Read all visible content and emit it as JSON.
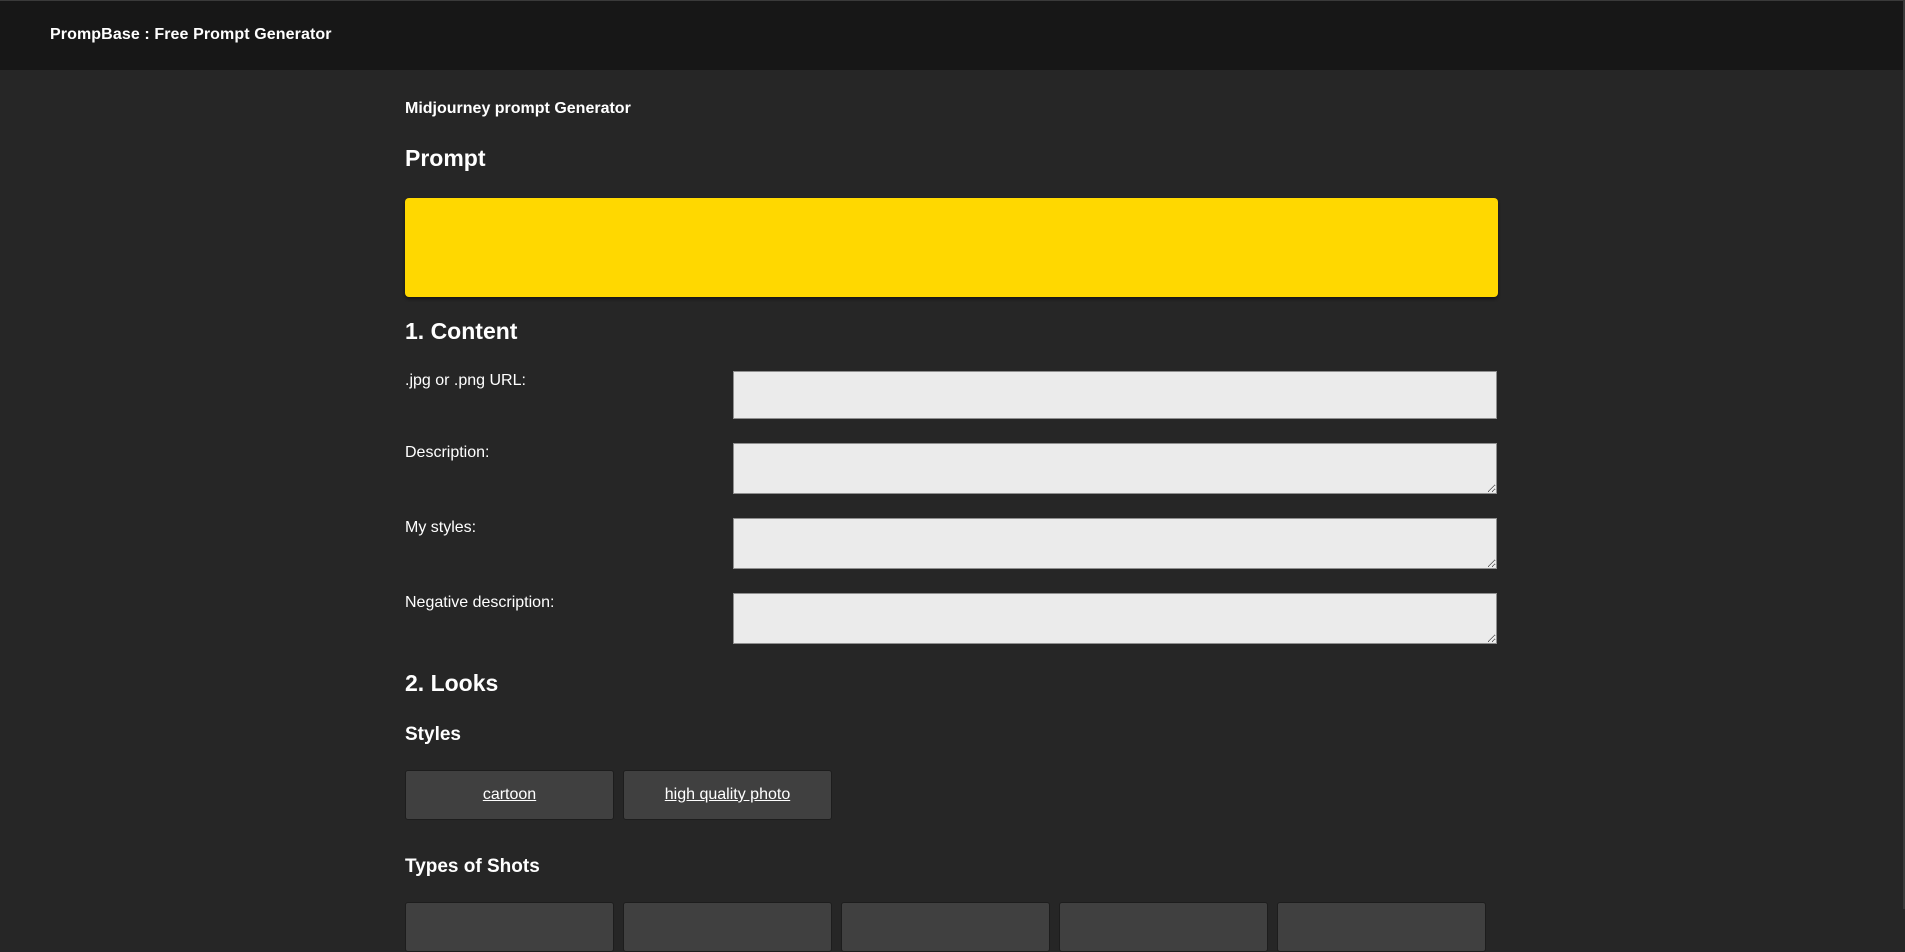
{
  "header": {
    "brand": "PrompBase : Free Prompt Generator"
  },
  "main": {
    "subtitle": "Midjourney prompt Generator",
    "prompt_heading": "Prompt",
    "prompt_value": "",
    "content": {
      "heading": "1. Content",
      "fields": [
        {
          "label": ".jpg or .png URL:",
          "value": ""
        },
        {
          "label": "Description:",
          "value": ""
        },
        {
          "label": "My styles:",
          "value": ""
        },
        {
          "label": "Negative description:",
          "value": ""
        }
      ]
    },
    "looks": {
      "heading": "2. Looks",
      "styles_heading": "Styles",
      "styles": [
        "cartoon",
        "high quality photo"
      ],
      "shots_heading": "Types of Shots",
      "shots": [
        "",
        "",
        "",
        "",
        ""
      ]
    }
  },
  "colors": {
    "page_bg": "#262626",
    "header_bg": "#171717",
    "prompt_bg": "#ffd800",
    "input_bg": "#ebebeb",
    "chip_bg": "#404040"
  }
}
